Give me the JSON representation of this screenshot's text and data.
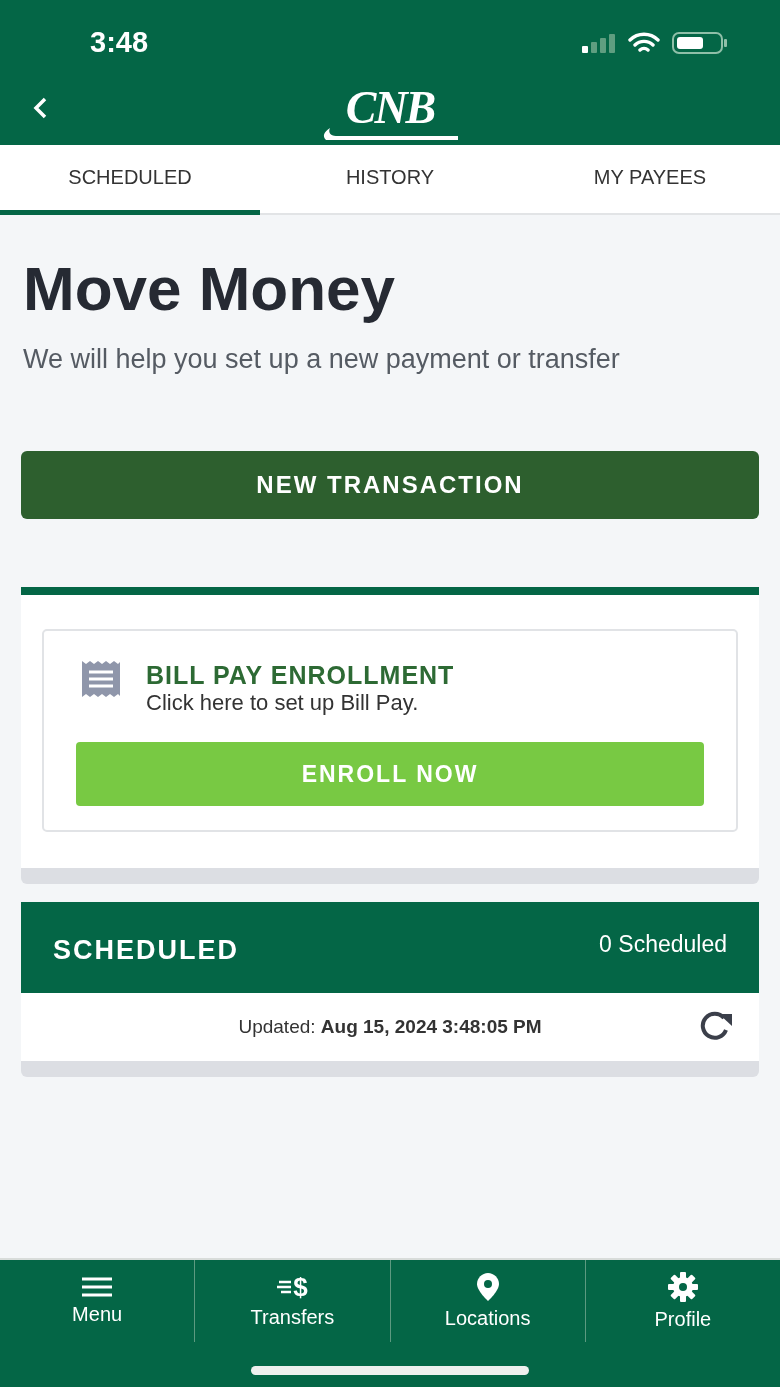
{
  "status_bar": {
    "time": "3:48"
  },
  "header": {
    "logo": "CNB"
  },
  "tabs": [
    {
      "label": "SCHEDULED",
      "selected": true
    },
    {
      "label": "HISTORY",
      "selected": false
    },
    {
      "label": "MY PAYEES",
      "selected": false
    }
  ],
  "page": {
    "title": "Move Money",
    "subtitle": "We will help you set up a new payment or transfer"
  },
  "new_transaction_button": "NEW TRANSACTION",
  "enrollment": {
    "title": "BILL PAY ENROLLMENT",
    "text": "Click here to set up Bill Pay.",
    "button": "ENROLL NOW"
  },
  "scheduled": {
    "title": "SCHEDULED",
    "count": "0 Scheduled",
    "updated": "Updated: **Aug 15, 2024 3:48:05 PM**"
  },
  "bottom_nav": [
    {
      "kind": "menu",
      "label": "Menu"
    },
    {
      "kind": "transfers",
      "label": "Transfers",
      "glyph": "$"
    },
    {
      "kind": "location",
      "label": "Locations"
    },
    {
      "kind": "gear",
      "label": "Profile"
    }
  ]
}
